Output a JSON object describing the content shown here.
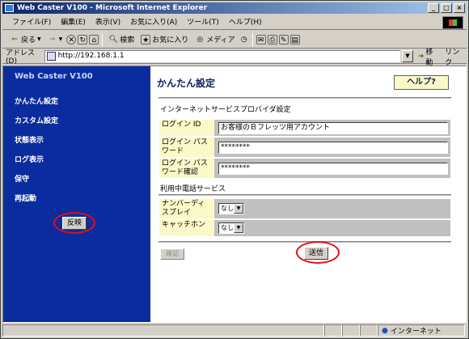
{
  "window": {
    "title": "Web Caster V100 - Microsoft Internet Explorer",
    "min": "_",
    "max": "□",
    "close": "×"
  },
  "menu": [
    "ファイル(F)",
    "編集(E)",
    "表示(V)",
    "お気に入り(A)",
    "ツール(T)",
    "ヘルプ(H)"
  ],
  "toolbar": {
    "back": "戻る",
    "search": "検索",
    "favorites": "お気に入り",
    "media": "メディア"
  },
  "address": {
    "label": "アドレス(D)",
    "url": "http://192.168.1.1",
    "go": "移動",
    "links": "リンク"
  },
  "sidebar": {
    "brand": "Web Caster V100",
    "items": [
      "かんたん設定",
      "カスタム設定",
      "状態表示",
      "ログ表示",
      "保守",
      "再起動"
    ],
    "reflect_button": "反映"
  },
  "main": {
    "title": "かんたん設定",
    "help_button": "ヘルプ?",
    "isp_section": "インターネットサービスプロバイダ設定",
    "login_id_label": "ログイン ID",
    "login_id_value": "お客様のＢフレッツ用アカウント",
    "password_label": "ログイン パスワード",
    "password_value": "********",
    "password_confirm_label": "ログイン パスワード確認",
    "password_confirm_value": "********",
    "phone_section": "利用中電話サービス",
    "number_display_label": "ナンバーディスプレイ",
    "number_display_value": "なし",
    "catch_phone_label": "キャッチホン",
    "catch_phone_value": "なし",
    "confirm_button": "確認",
    "send_button": "送信"
  },
  "status": {
    "zone": "インターネット"
  },
  "colors": {
    "sidebar_bg": "#0a2c9e",
    "label_bg": "#fbf9c8",
    "highlight": "#e01010"
  }
}
